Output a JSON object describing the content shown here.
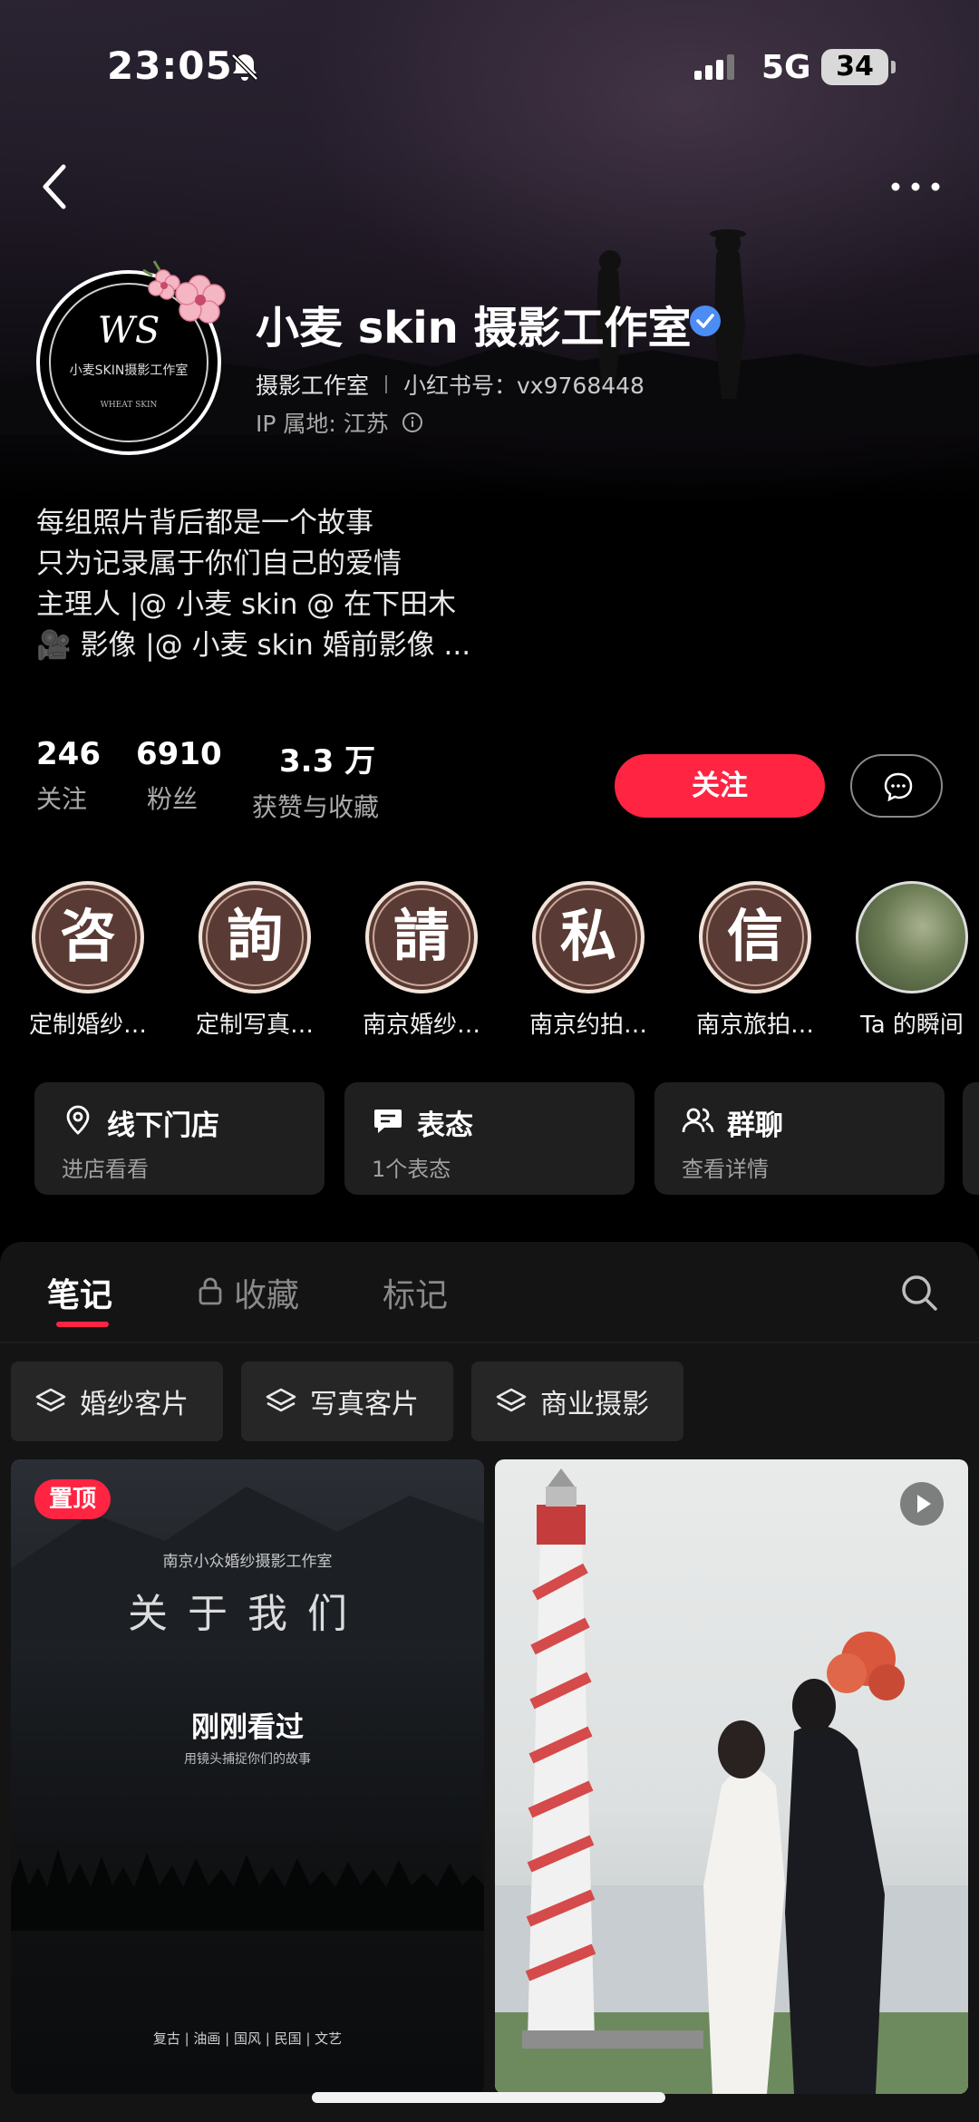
{
  "status_bar": {
    "time": "23:05",
    "network": "5G",
    "battery": "34"
  },
  "profile": {
    "name": "小麦 skin 摄影工作室",
    "category": "摄影工作室",
    "red_id": "小红书号：vx9768448",
    "ip_location": "IP 属地: 江苏",
    "avatar_monogram": "WS",
    "avatar_text": "小麦SKIN摄影工作室",
    "avatar_sub": "WHEAT SKIN",
    "bio": [
      "每组照片背后都是一个故事",
      "只为记录属于你们自己的爱情",
      "主理人 |@ 小麦 skin @ 在下田木",
      "🎥 影像 |@ 小麦 skin 婚前影像 ..."
    ]
  },
  "stats": {
    "following": {
      "value": "246",
      "label": "关注"
    },
    "followers": {
      "value": "6910",
      "label": "粉丝"
    },
    "likes": {
      "value": "3.3 万",
      "label": "获赞与收藏"
    }
  },
  "actions": {
    "follow": "关注"
  },
  "highlights": [
    {
      "glyph": "咨",
      "label": "定制婚纱…"
    },
    {
      "glyph": "詢",
      "label": "定制写真…"
    },
    {
      "glyph": "請",
      "label": "南京婚纱…"
    },
    {
      "glyph": "私",
      "label": "南京约拍…"
    },
    {
      "glyph": "信",
      "label": "南京旅拍…"
    },
    {
      "glyph": "",
      "label": "Ta 的瞬间"
    }
  ],
  "cards": [
    {
      "title": "线下门店",
      "sub": "进店看看",
      "icon": "location-pin-icon"
    },
    {
      "title": "表态",
      "sub": "1个表态",
      "icon": "chat-bubble-icon"
    },
    {
      "title": "群聊",
      "sub": "查看详情",
      "icon": "group-icon"
    }
  ],
  "tabs": {
    "notes": "笔记",
    "favorites": "收藏",
    "tags": "标记"
  },
  "filters": [
    "婚纱客片",
    "写真客片",
    "商业摄影"
  ],
  "posts": {
    "left": {
      "badge": "置顶",
      "line1": "南京小众婚纱摄影工作室",
      "line2": "关于我们",
      "line3": "刚刚看过",
      "line4": "用镜头捕捉你们的故事",
      "line5": "复古  |  油画  |  国风  |  民国  |  文艺"
    }
  },
  "colors": {
    "accent": "#ff2442",
    "background": "#000000",
    "panel": "#141414"
  }
}
